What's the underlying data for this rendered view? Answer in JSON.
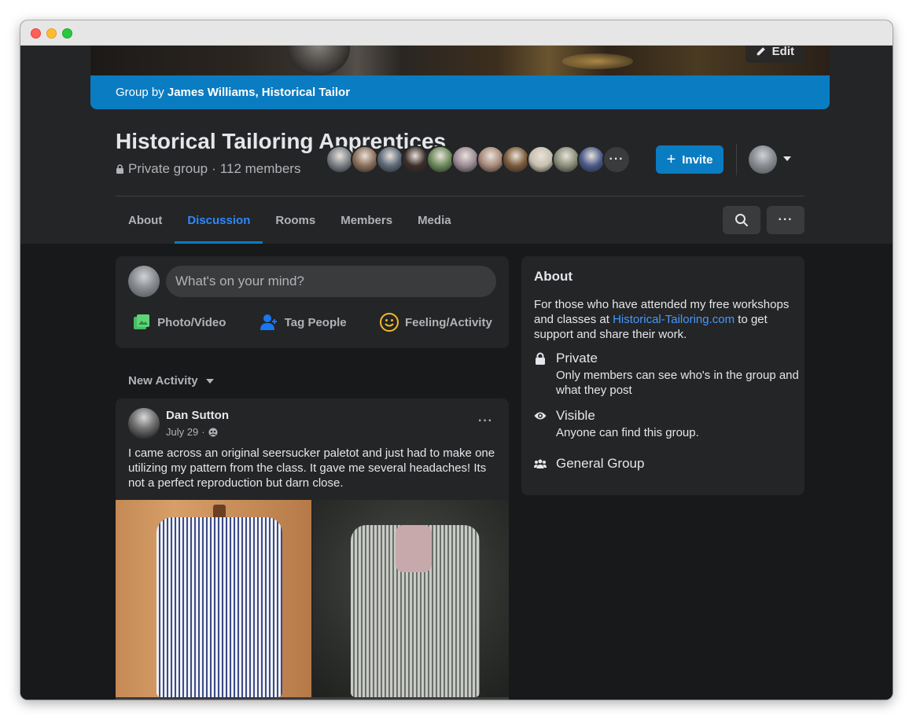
{
  "cover": {
    "edit_label": "Edit"
  },
  "group_by": {
    "prefix": "Group by",
    "owner": "James Williams, Historical Tailor"
  },
  "group": {
    "title": "Historical Tailoring Apprentices",
    "privacy": "Private group",
    "separator": "·",
    "members": "112 members"
  },
  "member_avatars": [
    "#7a7f86",
    "#8a6e5a",
    "#5d6a7a",
    "#3b2d2a",
    "#6a8a5a",
    "#9a8a96",
    "#a88a7a",
    "#7a5a3a",
    "#c8c0b0",
    "#8a8e78",
    "#4a5a8a"
  ],
  "member_avatars_more": "···",
  "actions": {
    "invite_label": "Invite",
    "invite_icon": "plus-icon"
  },
  "tabs": [
    {
      "label": "About",
      "active": false
    },
    {
      "label": "Discussion",
      "active": true
    },
    {
      "label": "Rooms",
      "active": false
    },
    {
      "label": "Members",
      "active": false
    },
    {
      "label": "Media",
      "active": false
    }
  ],
  "composer": {
    "placeholder": "What's on your mind?",
    "actions": [
      {
        "label": "Photo/Video",
        "icon": "photo-icon",
        "color": "#45bd62"
      },
      {
        "label": "Tag People",
        "icon": "tag-people-icon",
        "color": "#1877f2"
      },
      {
        "label": "Feeling/Activity",
        "icon": "feeling-icon",
        "color": "#f7b928"
      }
    ]
  },
  "feed": {
    "sort_label": "New Activity"
  },
  "post": {
    "author": "Dan Sutton",
    "date": "July 29",
    "date_separator": "·",
    "audience_icon": "group-audience-icon",
    "body": "I came across an original seersucker paletot and just had to make one utilizing my pattern from the class.  It gave me several headaches!  Its not a perfect reproduction but darn close."
  },
  "about": {
    "heading": "About",
    "desc_prefix": "For those who have attended my free workshops and classes at ",
    "desc_link": "Historical-Tailoring.com",
    "desc_suffix": " to get support and share their work.",
    "private_title": "Private",
    "private_sub": "Only members can see who's in the group and what they post",
    "visible_title": "Visible",
    "visible_sub": "Anyone can find this group.",
    "general_title": "General Group"
  },
  "colors": {
    "accent": "#0a7cc1",
    "link": "#4599ff",
    "surface": "#242526",
    "background": "#18191a",
    "text": "#e4e6eb",
    "secondary_text": "#b0b3b8"
  }
}
